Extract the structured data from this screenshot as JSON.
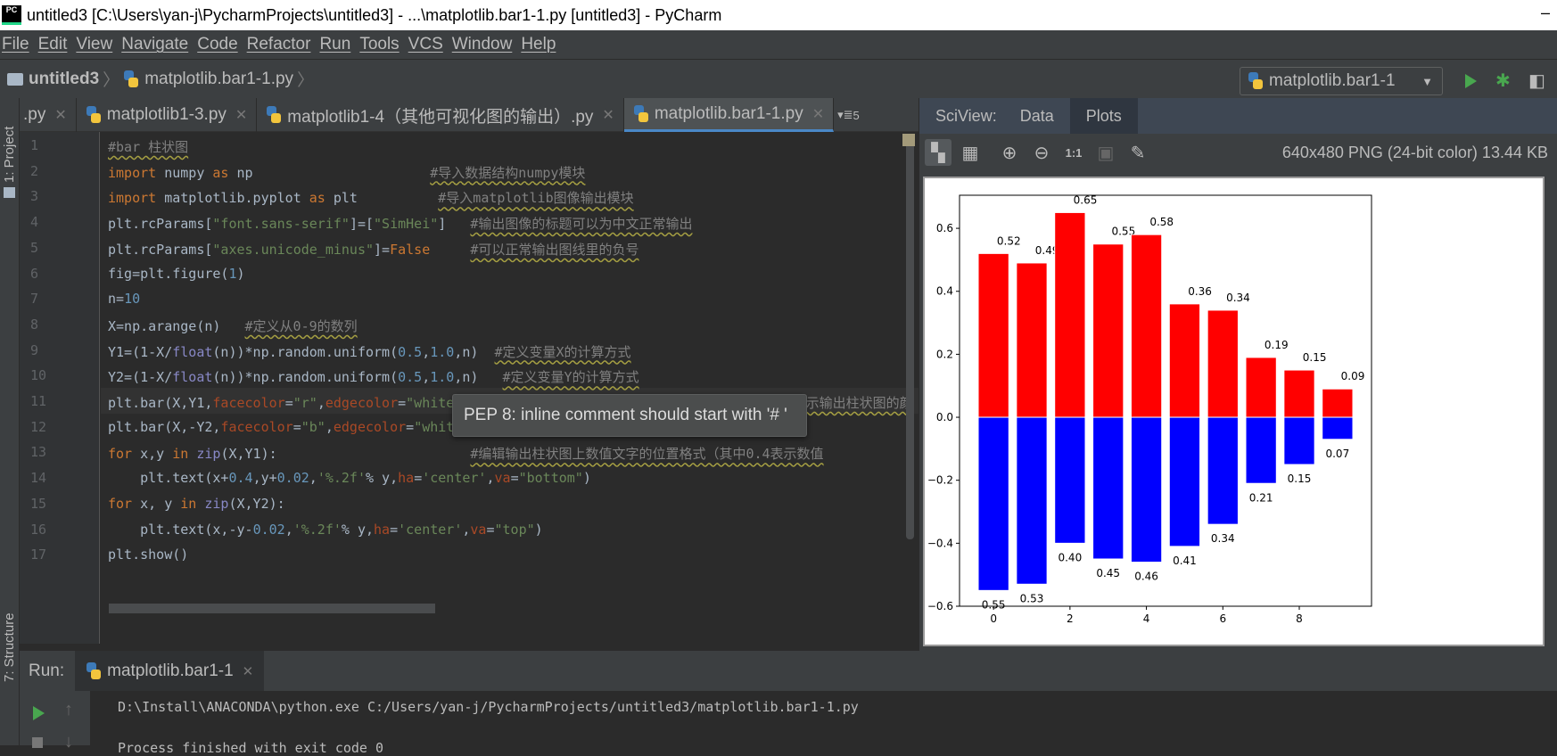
{
  "window": {
    "title": "untitled3 [C:\\Users\\yan-j\\PycharmProjects\\untitled3] - ...\\matplotlib.bar1-1.py [untitled3] - PyCharm",
    "logo": "PC",
    "minimize": "–"
  },
  "menu": [
    "File",
    "Edit",
    "View",
    "Navigate",
    "Code",
    "Refactor",
    "Run",
    "Tools",
    "VCS",
    "Window",
    "Help"
  ],
  "breadcrumb": {
    "project": "untitled3",
    "file": "matplotlib.bar1-1.py"
  },
  "run_config": {
    "label": "matplotlib.bar1-1"
  },
  "side_tools": {
    "project": "1: Project",
    "structure": "7: Structure"
  },
  "tabs": [
    {
      "label": ".py",
      "active": false
    },
    {
      "label": "matplotlib1-3.py",
      "active": false
    },
    {
      "label": "matplotlib1-4（其他可视化图的输出）.py",
      "active": false
    },
    {
      "label": "matplotlib.bar1-1.py",
      "active": true
    }
  ],
  "tab_overflow": "5",
  "code": [
    {
      "n": "1",
      "tokens": [
        {
          "t": "#bar 柱状图",
          "c": "cm"
        }
      ]
    },
    {
      "n": "2",
      "tokens": [
        {
          "t": "import",
          "c": "kw"
        },
        {
          "t": " numpy ",
          "c": "tx"
        },
        {
          "t": "as",
          "c": "kw"
        },
        {
          "t": " np                      ",
          "c": "tx"
        },
        {
          "t": "#导入数据结构numpy模块",
          "c": "cm"
        }
      ]
    },
    {
      "n": "3",
      "tokens": [
        {
          "t": "import",
          "c": "kw"
        },
        {
          "t": " matplotlib.pyplot ",
          "c": "tx"
        },
        {
          "t": "as",
          "c": "kw"
        },
        {
          "t": " plt          ",
          "c": "tx"
        },
        {
          "t": "#导入matplotlib图像输出模块",
          "c": "cm"
        }
      ]
    },
    {
      "n": "4",
      "tokens": [
        {
          "t": "plt.rcParams[",
          "c": "tx"
        },
        {
          "t": "\"font.sans-serif\"",
          "c": "st"
        },
        {
          "t": "]=[",
          "c": "tx"
        },
        {
          "t": "\"SimHei\"",
          "c": "st"
        },
        {
          "t": "]   ",
          "c": "tx"
        },
        {
          "t": "#输出图像的标题可以为中文正常输出",
          "c": "cm"
        }
      ]
    },
    {
      "n": "5",
      "tokens": [
        {
          "t": "plt.rcParams[",
          "c": "tx"
        },
        {
          "t": "\"axes.unicode_minus\"",
          "c": "st"
        },
        {
          "t": "]=",
          "c": "tx"
        },
        {
          "t": "False",
          "c": "kw"
        },
        {
          "t": "     ",
          "c": "tx"
        },
        {
          "t": "#可以正常输出图线里的负号",
          "c": "cm"
        }
      ]
    },
    {
      "n": "6",
      "tokens": [
        {
          "t": "fig=plt.figure(",
          "c": "tx"
        },
        {
          "t": "1",
          "c": "num"
        },
        {
          "t": ")",
          "c": "tx"
        }
      ]
    },
    {
      "n": "7",
      "tokens": [
        {
          "t": "n=",
          "c": "tx"
        },
        {
          "t": "10",
          "c": "num"
        }
      ]
    },
    {
      "n": "8",
      "tokens": [
        {
          "t": "X=np.arange(n)   ",
          "c": "tx"
        },
        {
          "t": "#定义从0-9的数列",
          "c": "cm"
        }
      ]
    },
    {
      "n": "9",
      "tokens": [
        {
          "t": "Y1=(1-X/",
          "c": "tx"
        },
        {
          "t": "float",
          "c": "bi"
        },
        {
          "t": "(n))*np.random.uniform(",
          "c": "tx"
        },
        {
          "t": "0.5",
          "c": "num"
        },
        {
          "t": ",",
          "c": "tx"
        },
        {
          "t": "1.0",
          "c": "num"
        },
        {
          "t": ",n)  ",
          "c": "tx"
        },
        {
          "t": "#定义变量X的计算方式",
          "c": "cm"
        }
      ]
    },
    {
      "n": "10",
      "tokens": [
        {
          "t": "Y2=(1-X/",
          "c": "tx"
        },
        {
          "t": "float",
          "c": "bi"
        },
        {
          "t": "(n))*np.random.uniform(",
          "c": "tx"
        },
        {
          "t": "0.5",
          "c": "num"
        },
        {
          "t": ",",
          "c": "tx"
        },
        {
          "t": "1.0",
          "c": "num"
        },
        {
          "t": ",n)   ",
          "c": "tx"
        },
        {
          "t": "#定义变量Y的计算方式",
          "c": "cm"
        }
      ]
    },
    {
      "n": "11",
      "tokens": [
        {
          "t": "plt.bar(X,Y1,",
          "c": "tx"
        },
        {
          "t": "facecolor",
          "c": "pr"
        },
        {
          "t": "=",
          "c": "tx"
        },
        {
          "t": "\"r\"",
          "c": "st"
        },
        {
          "t": ",",
          "c": "tx"
        },
        {
          "t": "edgecolor",
          "c": "pr"
        },
        {
          "t": "=",
          "c": "tx"
        },
        {
          "t": "\"white\")",
          "c": "st"
        },
        {
          "t": "                                        ",
          "c": "tx"
        },
        {
          "t": "表示输出柱状图的颜",
          "c": "cm"
        }
      ]
    },
    {
      "n": "12",
      "tokens": [
        {
          "t": "plt.bar(X,-Y2,",
          "c": "tx"
        },
        {
          "t": "facecolor",
          "c": "pr"
        },
        {
          "t": "=",
          "c": "tx"
        },
        {
          "t": "\"b\"",
          "c": "st"
        },
        {
          "t": ",",
          "c": "tx"
        },
        {
          "t": "edgecolor",
          "c": "pr"
        },
        {
          "t": "=",
          "c": "tx"
        },
        {
          "t": "\"white\")",
          "c": "st"
        }
      ]
    },
    {
      "n": "13",
      "tokens": [
        {
          "t": "for",
          "c": "kw"
        },
        {
          "t": " x,y ",
          "c": "tx"
        },
        {
          "t": "in",
          "c": "kw"
        },
        {
          "t": " ",
          "c": "tx"
        },
        {
          "t": "zip",
          "c": "bi"
        },
        {
          "t": "(X,Y1):                        ",
          "c": "tx"
        },
        {
          "t": "#编辑输出柱状图上数值文字的位置格式（其中0.4表示数值",
          "c": "cm"
        }
      ]
    },
    {
      "n": "14",
      "tokens": [
        {
          "t": "    plt.text(x+",
          "c": "tx"
        },
        {
          "t": "0.4",
          "c": "num"
        },
        {
          "t": ",y+",
          "c": "tx"
        },
        {
          "t": "0.02",
          "c": "num"
        },
        {
          "t": ",",
          "c": "tx"
        },
        {
          "t": "'%.2f'",
          "c": "st"
        },
        {
          "t": "% y,",
          "c": "tx"
        },
        {
          "t": "ha",
          "c": "pr"
        },
        {
          "t": "=",
          "c": "tx"
        },
        {
          "t": "'center'",
          "c": "st"
        },
        {
          "t": ",",
          "c": "tx"
        },
        {
          "t": "va",
          "c": "pr"
        },
        {
          "t": "=",
          "c": "tx"
        },
        {
          "t": "\"bottom\"",
          "c": "st"
        },
        {
          "t": ")",
          "c": "tx"
        }
      ]
    },
    {
      "n": "15",
      "tokens": [
        {
          "t": "for",
          "c": "kw"
        },
        {
          "t": " x, y ",
          "c": "tx"
        },
        {
          "t": "in",
          "c": "kw"
        },
        {
          "t": " ",
          "c": "tx"
        },
        {
          "t": "zip",
          "c": "bi"
        },
        {
          "t": "(X,Y2):",
          "c": "tx"
        }
      ]
    },
    {
      "n": "16",
      "tokens": [
        {
          "t": "    plt.text(x,-y-",
          "c": "tx"
        },
        {
          "t": "0.02",
          "c": "num"
        },
        {
          "t": ",",
          "c": "tx"
        },
        {
          "t": "'%.2f'",
          "c": "st"
        },
        {
          "t": "% y,",
          "c": "tx"
        },
        {
          "t": "ha",
          "c": "pr"
        },
        {
          "t": "=",
          "c": "tx"
        },
        {
          "t": "'center'",
          "c": "st"
        },
        {
          "t": ",",
          "c": "tx"
        },
        {
          "t": "va",
          "c": "pr"
        },
        {
          "t": "=",
          "c": "tx"
        },
        {
          "t": "\"top\"",
          "c": "st"
        },
        {
          "t": ")",
          "c": "tx"
        }
      ]
    },
    {
      "n": "17",
      "tokens": [
        {
          "t": "plt.show()",
          "c": "tx"
        }
      ]
    }
  ],
  "tooltip": "PEP 8: inline comment should start with '# '",
  "sciview": {
    "label": "SciView:",
    "tabs": [
      "Data",
      "Plots"
    ],
    "active_tab": "Plots",
    "image_info": "640x480 PNG (24-bit color) 13.44 KB",
    "zoom_1to1": "1:1"
  },
  "run": {
    "label": "Run:",
    "tab": "matplotlib.bar1-1",
    "command": "D:\\Install\\ANACONDA\\python.exe C:/Users/yan-j/PycharmProjects/untitled3/matplotlib.bar1-1.py",
    "finished": "Process finished with exit code 0"
  },
  "chart_data": {
    "type": "bar",
    "x": [
      0,
      1,
      2,
      3,
      4,
      5,
      6,
      7,
      8,
      9
    ],
    "series": [
      {
        "values": [
          0.52,
          0.49,
          0.65,
          0.55,
          0.58,
          0.36,
          0.34,
          0.19,
          0.15,
          0.09
        ],
        "color": "#ff0000",
        "labels": [
          "0.52",
          "0.49",
          "0.65",
          "0.55",
          "0.58",
          "0.36",
          "0.34",
          "0.19",
          "0.15",
          "0.09"
        ]
      },
      {
        "values": [
          -0.55,
          -0.53,
          -0.4,
          -0.45,
          -0.46,
          -0.41,
          -0.34,
          -0.21,
          -0.15,
          -0.07
        ],
        "color": "#0000ff",
        "labels": [
          "0.55",
          "0.53",
          "0.40",
          "0.45",
          "0.46",
          "0.41",
          "0.34",
          "0.21",
          "0.15",
          "0.07"
        ]
      }
    ],
    "edgecolor": "#ffffff",
    "xlim": [
      -0.89,
      9.89
    ],
    "ylim": [
      -0.6,
      0.705
    ],
    "xticks": [
      "0",
      "2",
      "4",
      "6",
      "8"
    ],
    "yticks": [
      "−0.6",
      "−0.4",
      "−0.2",
      "0.0",
      "0.2",
      "0.4",
      "0.6"
    ],
    "grid": false
  }
}
